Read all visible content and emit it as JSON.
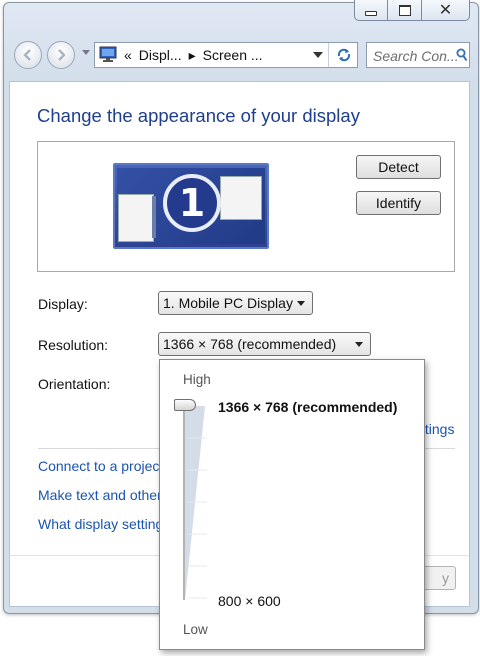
{
  "window": {
    "caption_buttons": {
      "minimize": "minimize-icon",
      "maximize": "maximize-icon",
      "close_glyph": "✕"
    }
  },
  "navigation": {
    "breadcrumb_prefix": "«",
    "breadcrumb": [
      "Displ...",
      "Screen ..."
    ],
    "breadcrumb_separator": "▸",
    "search_placeholder": "Search Con...",
    "icons": {
      "back": "back-arrow-icon",
      "forward": "forward-arrow-icon",
      "refresh": "refresh-icon",
      "search": "search-icon",
      "location": "display-control-panel-icon"
    }
  },
  "main": {
    "title": "Change the appearance of your display",
    "monitor_number": "1",
    "detect_label": "Detect",
    "identify_label": "Identify",
    "display_label": "Display:",
    "display_value": "1. Mobile PC Display",
    "resolution_label": "Resolution:",
    "resolution_value": "1366 × 768 (recommended)",
    "orientation_label": "Orientation:",
    "advanced_link_fragment": "ttings",
    "links": [
      "Connect to a projec",
      "Make text and other",
      "What display setting"
    ],
    "apply_fragment": "y"
  },
  "resolution_popup": {
    "high_label": "High",
    "low_label": "Low",
    "top_value": "1366 × 768 (recommended)",
    "bottom_value": "800 × 600",
    "slider_position": 1.0
  },
  "colors": {
    "title": "#1e3f8e",
    "link": "#1a54b0",
    "accent_monitor": "#2c4290"
  }
}
